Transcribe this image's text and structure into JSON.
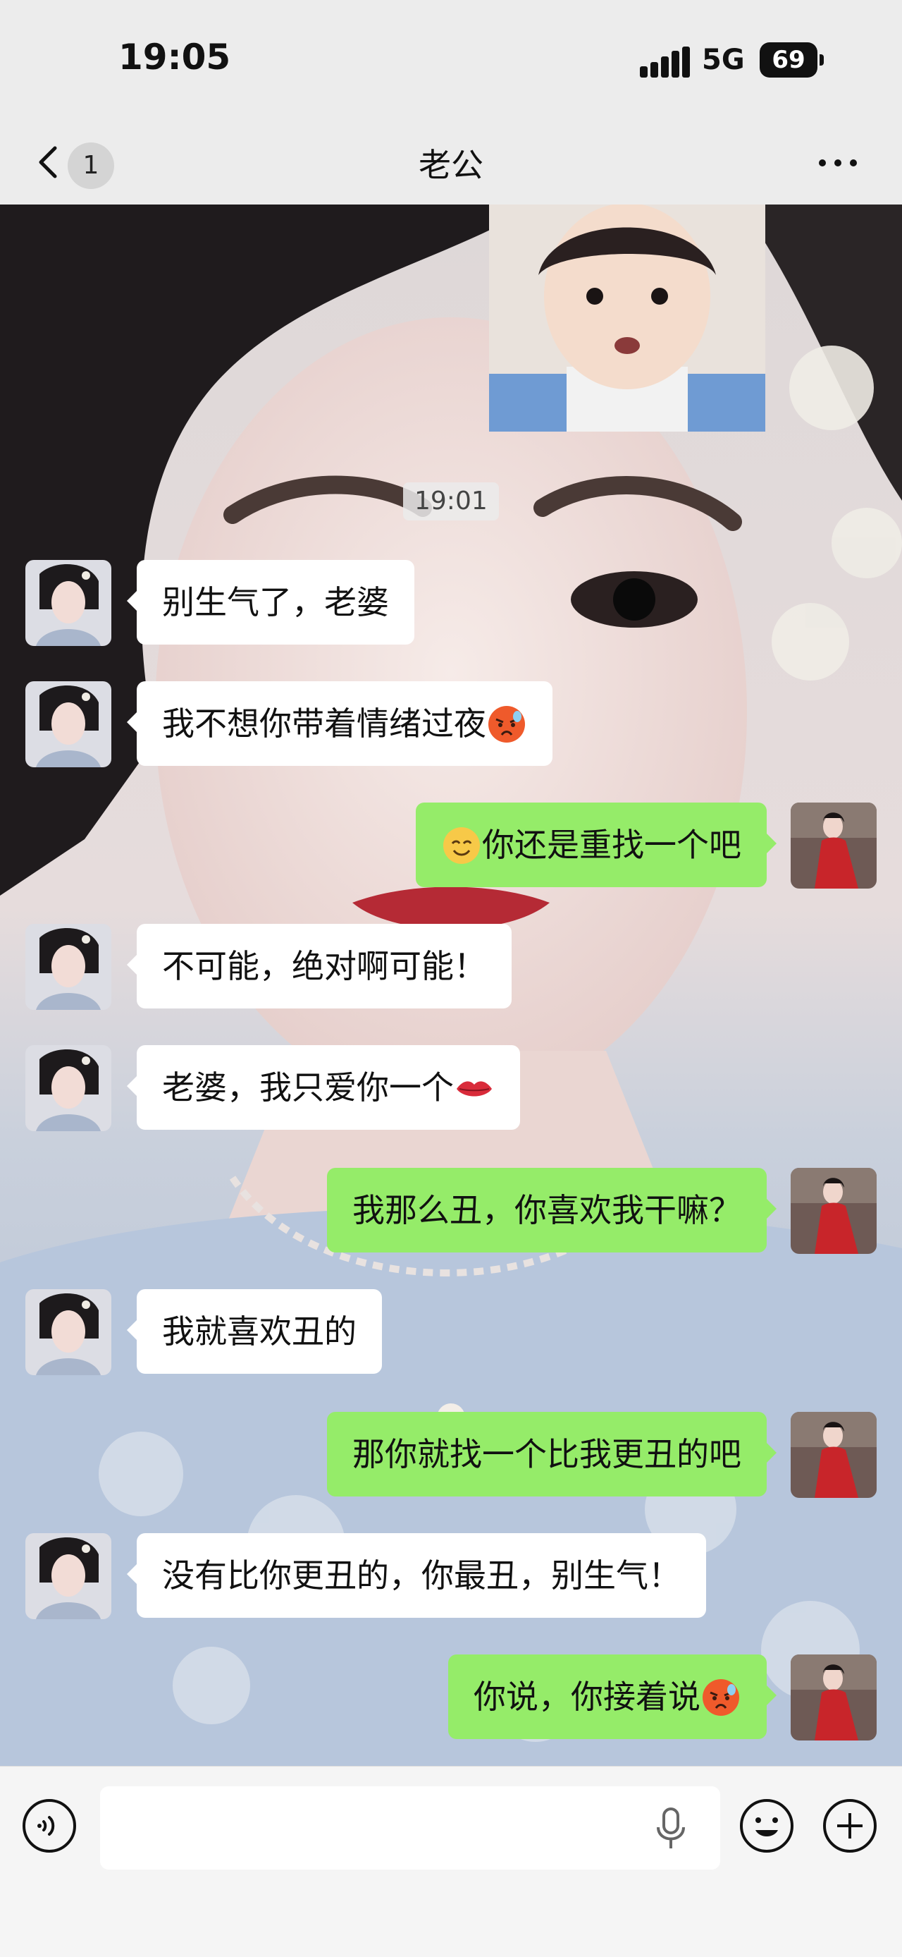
{
  "status_bar": {
    "time": "19:05",
    "network": "5G",
    "battery": "69"
  },
  "nav": {
    "back_badge": "1",
    "title": "老公"
  },
  "chat": {
    "timestamp": "19:01",
    "messages": [
      {
        "side": "in",
        "text": "别生气了，老婆",
        "emoji": ""
      },
      {
        "side": "in",
        "text": "我不想你带着情绪过夜",
        "emoji": "angry-face"
      },
      {
        "side": "out",
        "text": "你还是重找一个吧",
        "emoji_prefix": "smile-face"
      },
      {
        "side": "in",
        "text": "不可能，绝对啊可能！",
        "emoji": ""
      },
      {
        "side": "in",
        "text": "老婆，我只爱你一个",
        "emoji": "lips"
      },
      {
        "side": "out",
        "text": "我那么丑，你喜欢我干嘛？",
        "emoji": ""
      },
      {
        "side": "in",
        "text": "我就喜欢丑的",
        "emoji": ""
      },
      {
        "side": "out",
        "text": "那你就找一个比我更丑的吧",
        "emoji": ""
      },
      {
        "side": "in",
        "text": "没有比你更丑的，你最丑，别生气！",
        "emoji": ""
      },
      {
        "side": "out",
        "text": "你说，你接着说",
        "emoji": "angry-face"
      }
    ]
  },
  "input": {
    "placeholder": ""
  },
  "icons": {
    "back": "chevron-left-icon",
    "more": "more-dots-icon",
    "voice": "voice-icon",
    "mic": "microphone-icon",
    "emoji": "emoji-icon",
    "plus": "plus-icon"
  },
  "colors": {
    "outgoing_bubble": "#95ec69",
    "incoming_bubble": "#ffffff",
    "bar_background": "#ececec"
  }
}
